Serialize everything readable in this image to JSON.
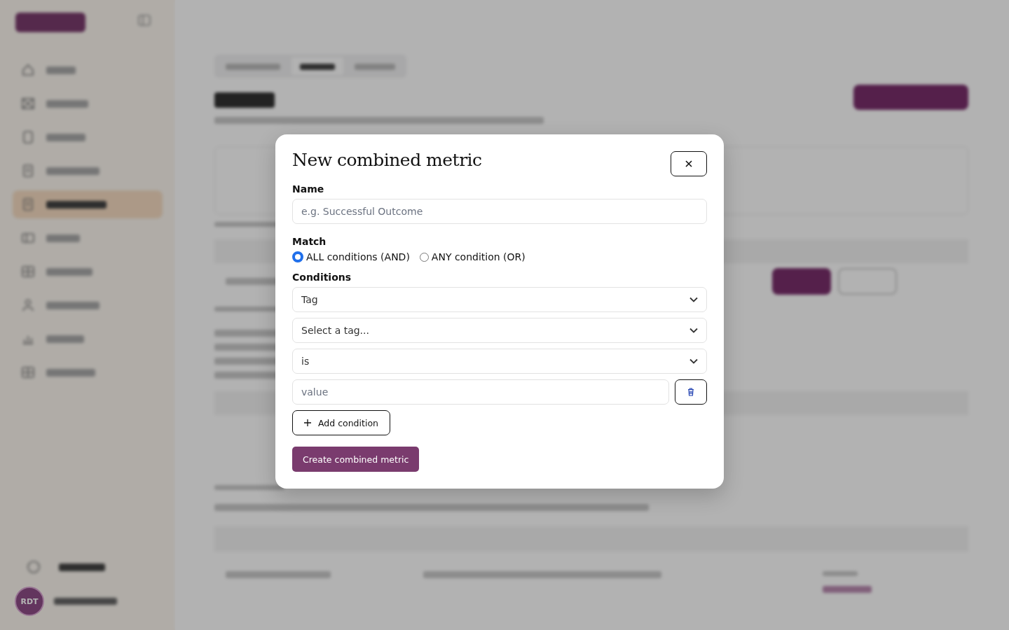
{
  "background": {
    "nav": [
      {
        "selected": false
      },
      {
        "selected": false
      },
      {
        "selected": false
      },
      {
        "selected": false
      },
      {
        "selected": true
      },
      {
        "selected": false
      },
      {
        "selected": false
      },
      {
        "selected": false
      },
      {
        "selected": false
      },
      {
        "selected": false
      }
    ],
    "avatar": "RDT",
    "tabs": [
      {
        "selected": false
      },
      {
        "selected": true
      },
      {
        "selected": false
      }
    ]
  },
  "modal": {
    "title": "New combined metric",
    "name": {
      "label": "Name",
      "placeholder": "e.g. Successful Outcome"
    },
    "match": {
      "label": "Match",
      "options": [
        {
          "label": "ALL conditions (AND)",
          "selected": true
        },
        {
          "label": "ANY condition (OR)",
          "selected": false
        }
      ]
    },
    "conditions": {
      "label": "Conditions",
      "rows": [
        {
          "kind": "select",
          "value": "Tag"
        },
        {
          "kind": "select",
          "value": "Select a tag..."
        },
        {
          "kind": "select",
          "value": "is"
        },
        {
          "kind": "input",
          "placeholder": "value"
        }
      ]
    },
    "add_button": "Add condition",
    "submit": "Create combined metric"
  }
}
